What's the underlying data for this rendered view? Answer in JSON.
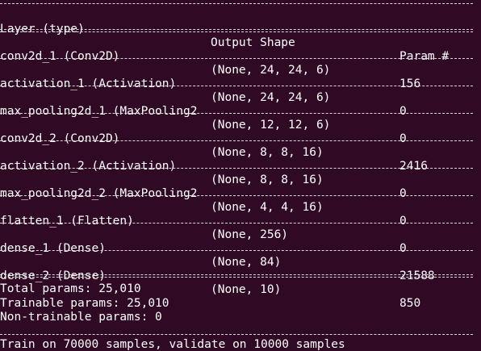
{
  "window": {
    "background_color": "#300a24",
    "text_color": "#ffffff"
  },
  "model_summary": {
    "headers": {
      "layer": "Layer (type)",
      "output_shape": "Output Shape",
      "params": "Param #"
    },
    "layers": [
      {
        "layer": "conv2d_1 (Conv2D)",
        "output_shape": "(None, 24, 24, 6)",
        "params": "156"
      },
      {
        "layer": "activation_1 (Activation)",
        "output_shape": "(None, 24, 24, 6)",
        "params": "0"
      },
      {
        "layer": "max_pooling2d_1 (MaxPooling2",
        "output_shape": "(None, 12, 12, 6)",
        "params": "0"
      },
      {
        "layer": "conv2d_2 (Conv2D)",
        "output_shape": "(None, 8, 8, 16)",
        "params": "2416"
      },
      {
        "layer": "activation_2 (Activation)",
        "output_shape": "(None, 8, 8, 16)",
        "params": "0"
      },
      {
        "layer": "max_pooling2d_2 (MaxPooling2",
        "output_shape": "(None, 4, 4, 16)",
        "params": "0"
      },
      {
        "layer": "flatten_1 (Flatten)",
        "output_shape": "(None, 256)",
        "params": "0"
      },
      {
        "layer": "dense_1 (Dense)",
        "output_shape": "(None, 84)",
        "params": "21588"
      },
      {
        "layer": "dense_2 (Dense)",
        "output_shape": "(None, 10)",
        "params": "850"
      }
    ],
    "totals": {
      "total_params": "Total params: 25,010",
      "trainable_params": "Trainable params: 25,010",
      "non_trainable_params": "Non-trainable params: 0"
    },
    "train_message": "Train on 70000 samples, validate on 10000 samples"
  }
}
